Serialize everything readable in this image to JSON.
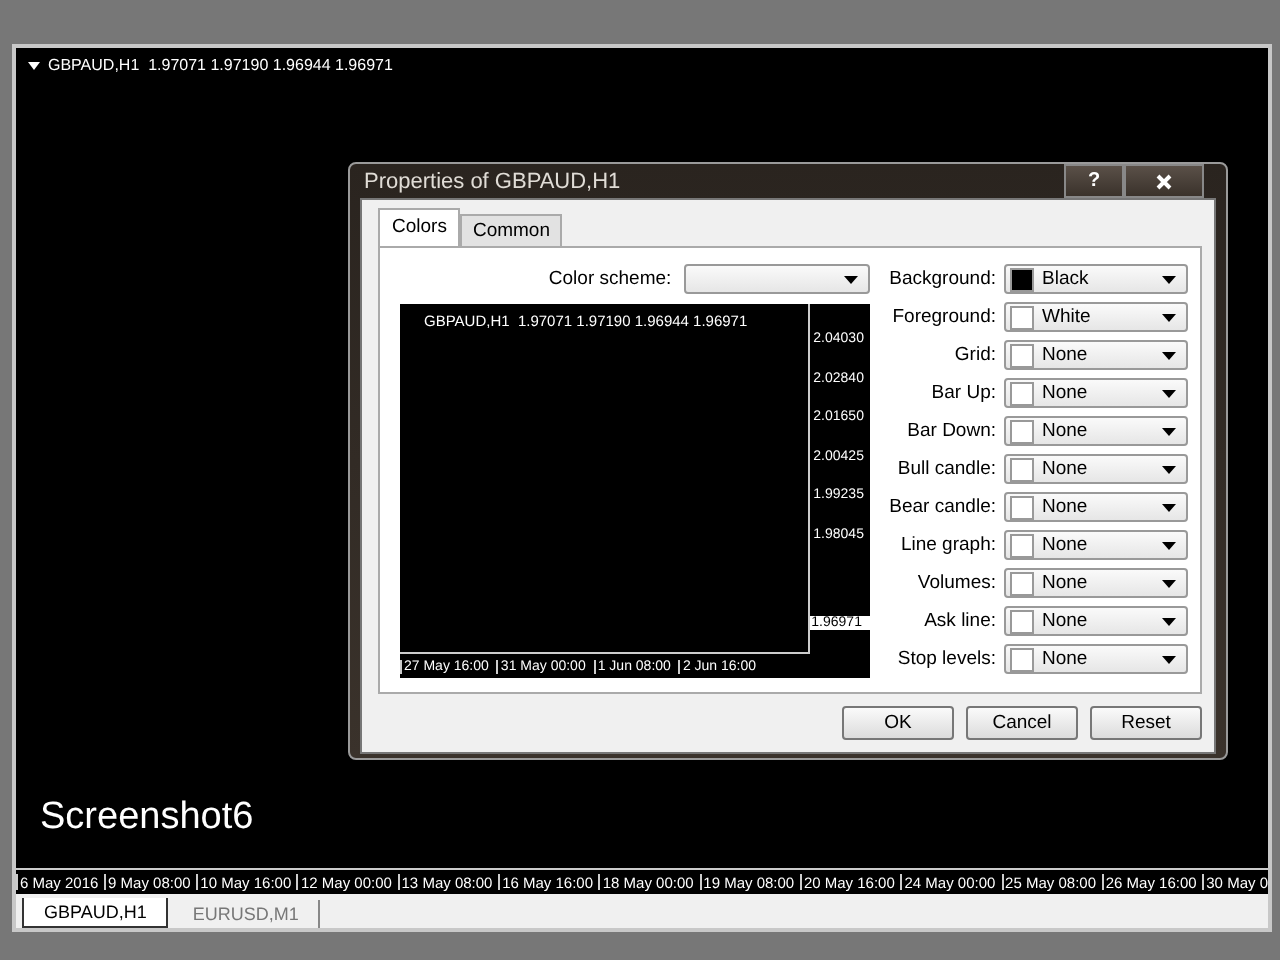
{
  "chart_window": {
    "header": "GBPAUD,H1  1.97071 1.97190 1.96944 1.96971",
    "caption": "Screenshot6",
    "time_labels": [
      "6 May 2016",
      "9 May 08:00",
      "10 May 16:00",
      "12 May 00:00",
      "13 May 08:00",
      "16 May 16:00",
      "18 May 00:00",
      "19 May 08:00",
      "20 May 16:00",
      "24 May 00:00",
      "25 May 08:00",
      "26 May 16:00",
      "30 May 0"
    ]
  },
  "dialog": {
    "title": "Properties of GBPAUD,H1",
    "help_button": "?",
    "tabs": [
      {
        "label": "Colors",
        "selected": true
      },
      {
        "label": "Common",
        "selected": false
      }
    ],
    "color_scheme": {
      "label": "Color scheme:"
    },
    "preview": {
      "header": "GBPAUD,H1  1.97071 1.97190 1.96944 1.96971",
      "price_labels": [
        "2.04030",
        "2.02840",
        "2.01650",
        "2.00425",
        "1.99235",
        "1.98045"
      ],
      "current_price": "1.96971",
      "time_labels": [
        "27 May 16:00",
        "31 May 00:00",
        "1 Jun 08:00",
        "2 Jun 16:00"
      ]
    },
    "color_settings": [
      {
        "label": "Background:",
        "value": "Black",
        "color": "#000000"
      },
      {
        "label": "Foreground:",
        "value": "White",
        "color": "#ffffff"
      },
      {
        "label": "Grid:",
        "value": "None",
        "color": "#ffffff"
      },
      {
        "label": "Bar Up:",
        "value": "None",
        "color": "#ffffff"
      },
      {
        "label": "Bar Down:",
        "value": "None",
        "color": "#ffffff"
      },
      {
        "label": "Bull candle:",
        "value": "None",
        "color": "#ffffff"
      },
      {
        "label": "Bear candle:",
        "value": "None",
        "color": "#ffffff"
      },
      {
        "label": "Line graph:",
        "value": "None",
        "color": "#ffffff"
      },
      {
        "label": "Volumes:",
        "value": "None",
        "color": "#ffffff"
      },
      {
        "label": "Ask line:",
        "value": "None",
        "color": "#ffffff"
      },
      {
        "label": "Stop levels:",
        "value": "None",
        "color": "#ffffff"
      }
    ],
    "buttons": [
      "OK",
      "Cancel",
      "Reset"
    ]
  },
  "chart_tabs": [
    {
      "label": "GBPAUD,H1",
      "selected": true
    },
    {
      "label": "EURUSD,M1",
      "selected": false
    }
  ]
}
